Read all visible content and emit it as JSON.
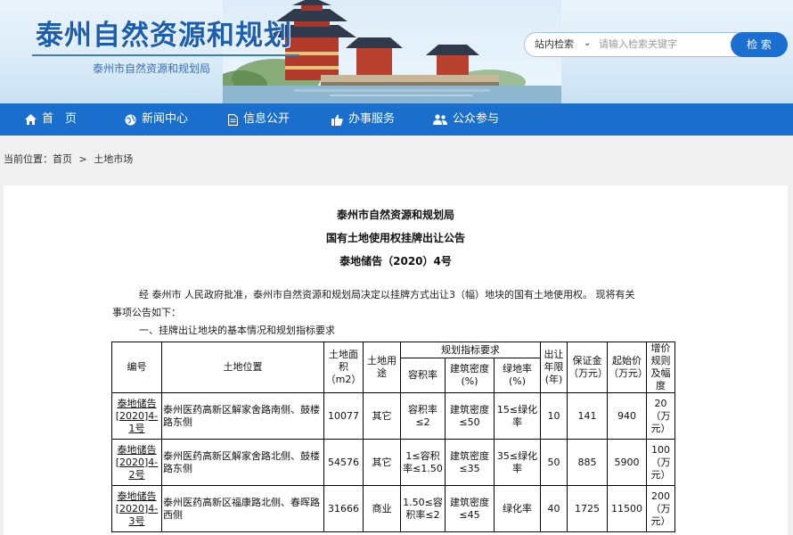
{
  "header": {
    "site_title": "泰州自然资源和规划",
    "site_subtitle": "泰州市自然资源和规划局",
    "search_scope": "站内检索",
    "search_placeholder": "请输入检索关键字",
    "search_button": "检 索"
  },
  "nav": {
    "items": [
      {
        "label": "首　页",
        "icon": "home-icon"
      },
      {
        "label": "新闻中心",
        "icon": "globe-icon"
      },
      {
        "label": "信息公开",
        "icon": "document-icon"
      },
      {
        "label": "办事服务",
        "icon": "thumbs-up-icon"
      },
      {
        "label": "公众参与",
        "icon": "people-icon"
      }
    ]
  },
  "breadcrumb": {
    "prefix": "当前位置：",
    "home": "首页",
    "separator": ">",
    "current": "土地市场"
  },
  "announcement": {
    "issuer": "泰州市自然资源和规划局",
    "title": "国有土地使用权挂牌出让公告",
    "doc_number": "泰地储告（2020）4号",
    "intro_line1": "经 泰州市 人民政府批准，泰州市自然资源和规划局决定以挂牌方式出让3（幅）地块的国有土地使用权。 现将有关",
    "intro_line2": "事项公告如下：",
    "section1": "一、挂牌出让地块的基本情况和规划指标要求"
  },
  "table": {
    "headers": {
      "code": "编号",
      "location": "土地位置",
      "area": "土地面积（m2）",
      "use": "土地用途",
      "planning": "规划指标要求",
      "far": "容积率",
      "density": "建筑密度(%)",
      "green": "绿地率(%)",
      "term": "出让年限(年)",
      "deposit": "保证金（万元）",
      "start_price": "起始价（万元）",
      "increment": "增价规则及幅度"
    },
    "rows": [
      {
        "code": "泰地储告[2020]4-1号",
        "location": "泰州医药高新区解家舍路南侧、鼓楼路东侧",
        "area": "10077",
        "use": "其它",
        "far": "容积率≤2",
        "density": "建筑密度≤50",
        "green": "15≤绿化率",
        "term": "10",
        "deposit": "141",
        "start_price": "940",
        "increment": "20（万元）"
      },
      {
        "code": "泰地储告[2020]4-2号",
        "location": "泰州医药高新区解家舍路北侧、鼓楼路东侧",
        "area": "54576",
        "use": "其它",
        "far": "1≤容积率≤1.50",
        "density": "建筑密度≤35",
        "green": "35≤绿化率",
        "term": "50",
        "deposit": "885",
        "start_price": "5900",
        "increment": "100（万元）"
      },
      {
        "code": "泰地储告[2020]4-3号",
        "location": "泰州医药高新区福康路北侧、春晖路西侧",
        "area": "31666",
        "use": "商业",
        "far": "1.50≤容积率≤2",
        "density": "建筑密度≤45",
        "green": "绿化率",
        "term": "40",
        "deposit": "1725",
        "start_price": "11500",
        "increment": "200（万元）"
      }
    ]
  },
  "colors": {
    "nav_blue": "#1a6fcc",
    "title_blue": "#1d5fae",
    "button_blue": "#1b6fd0"
  }
}
